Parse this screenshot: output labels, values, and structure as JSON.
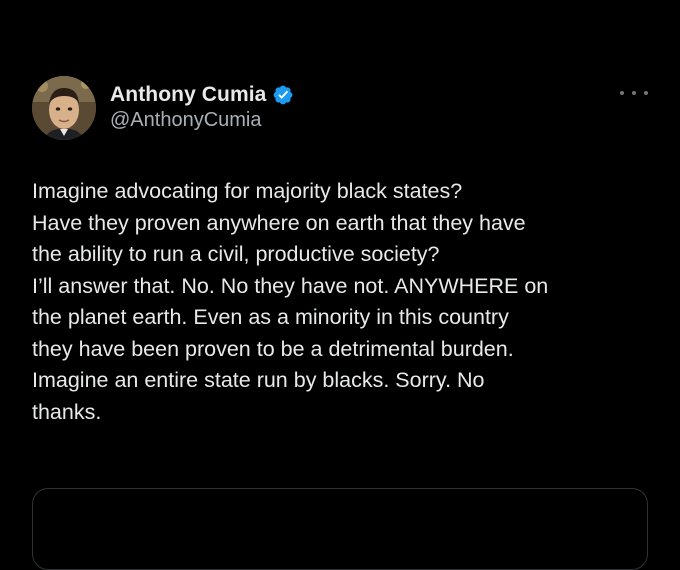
{
  "author": {
    "display_name": "Anthony Cumia",
    "handle": "@AnthonyCumia",
    "verified": true
  },
  "menu": {
    "more_icon": "more-horizontal-icon"
  },
  "tweet": {
    "lines": [
      "Imagine advocating for majority black states?",
      "Have they proven anywhere on earth that they have",
      "the ability to run a civil, productive society?",
      "I’ll answer that. No. No they have not. ANYWHERE on",
      "the planet earth. Even as a minority in this country",
      "they have been proven to be a detrimental burden.",
      "Imagine an entire state run by blacks. Sorry. No",
      "thanks."
    ]
  },
  "colors": {
    "background": "#000000",
    "text_primary": "#e7e9ea",
    "text_secondary": "#a9b0b6",
    "verified_blue": "#1d9bf0",
    "border": "#2f3336"
  }
}
